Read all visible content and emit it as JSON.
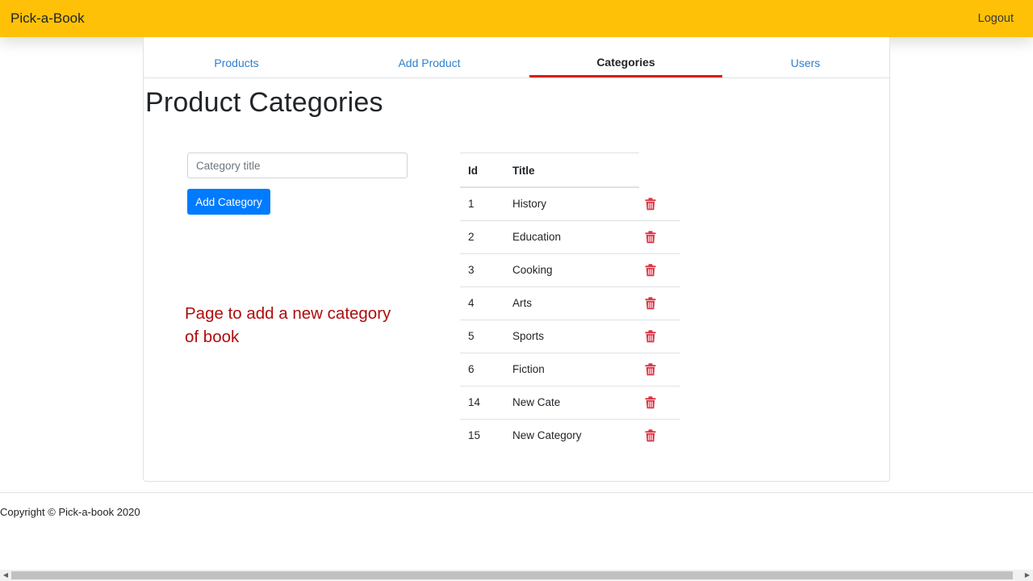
{
  "navbar": {
    "brand": "Pick-a-Book",
    "logout_label": "Logout",
    "color": "#ffc107"
  },
  "tabs": [
    {
      "label": "Products",
      "active": false
    },
    {
      "label": "Add Product",
      "active": false
    },
    {
      "label": "Categories",
      "active": true
    },
    {
      "label": "Users",
      "active": false
    }
  ],
  "page": {
    "title": "Product Categories",
    "input_placeholder": "Category title",
    "add_button_label": "Add Category",
    "note_line1": "Page to add a new category",
    "note_line2": "of book"
  },
  "table": {
    "headers": {
      "id": "Id",
      "title": "Title"
    },
    "rows": [
      {
        "id": "1",
        "title": "History"
      },
      {
        "id": "2",
        "title": "Education"
      },
      {
        "id": "3",
        "title": "Cooking"
      },
      {
        "id": "4",
        "title": "Arts"
      },
      {
        "id": "5",
        "title": "Sports"
      },
      {
        "id": "6",
        "title": "Fiction"
      },
      {
        "id": "14",
        "title": "New Cate"
      },
      {
        "id": "15",
        "title": "New Category"
      }
    ]
  },
  "footer": {
    "copyright": "Copyright © Pick-a-book 2020"
  },
  "colors": {
    "accent": "#007bff",
    "delete": "#dc3545",
    "tab_underline": "#d91e18",
    "note": "#b00b0b"
  }
}
